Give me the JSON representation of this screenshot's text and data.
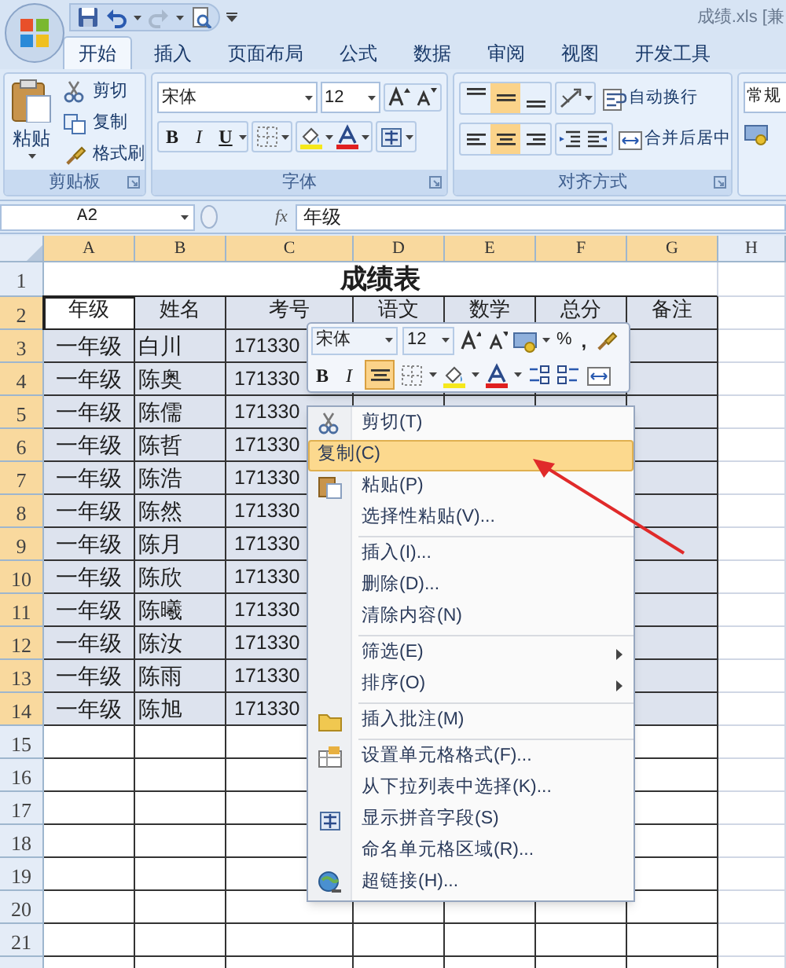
{
  "window": {
    "title": "成绩.xls [兼"
  },
  "tabs": [
    {
      "label": "开始",
      "selected": true
    },
    {
      "label": "插入",
      "selected": false
    },
    {
      "label": "页面布局",
      "selected": false
    },
    {
      "label": "公式",
      "selected": false
    },
    {
      "label": "数据",
      "selected": false
    },
    {
      "label": "审阅",
      "selected": false
    },
    {
      "label": "视图",
      "selected": false
    },
    {
      "label": "开发工具",
      "selected": false
    }
  ],
  "ribbon": {
    "clipboard": {
      "label": "剪贴板",
      "paste": "粘贴",
      "items": [
        "剪切",
        "复制",
        "格式刷"
      ]
    },
    "font": {
      "label": "字体",
      "font": "宋体",
      "size": "12",
      "styles": [
        "B",
        "I",
        "U"
      ]
    },
    "alignment": {
      "label": "对齐方式",
      "vertical": [
        {
          "selected": false
        },
        {
          "selected": true
        },
        {
          "selected": false
        }
      ],
      "horizontal": [
        {
          "selected": false
        },
        {
          "selected": true
        },
        {
          "selected": false
        }
      ],
      "wrap": "自动换行",
      "merge": "合并后居中"
    },
    "number": {
      "format": "常规"
    }
  },
  "formula_bar": {
    "name_box": "A2",
    "function_label": "fx",
    "value": "年级"
  },
  "sheet": {
    "columns": [
      {
        "label": "A",
        "selected": true
      },
      {
        "label": "B",
        "selected": true
      },
      {
        "label": "C",
        "selected": true
      },
      {
        "label": "D",
        "selected": true
      },
      {
        "label": "E",
        "selected": true
      },
      {
        "label": "F",
        "selected": true
      },
      {
        "label": "G",
        "selected": true
      },
      {
        "label": "H",
        "selected": false
      }
    ],
    "rows": [
      {
        "header": "1",
        "selected": false,
        "title": "成绩表"
      },
      {
        "header": "2",
        "selected": true,
        "cells": [
          {
            "text": "年级",
            "active": true
          },
          {
            "text": "姓名",
            "active": false
          },
          {
            "text": "考号",
            "active": false
          },
          {
            "text": "语文",
            "active": false
          },
          {
            "text": "数学",
            "active": false
          },
          {
            "text": "总分",
            "active": false
          },
          {
            "text": "备注",
            "active": false
          }
        ]
      },
      {
        "header": "3",
        "selected": true,
        "cells": [
          {
            "text": "一年级",
            "active": false
          },
          {
            "text": "白川",
            "active": false
          },
          {
            "text": "171330",
            "active": false
          }
        ]
      },
      {
        "header": "4",
        "selected": true,
        "cells": [
          {
            "text": "一年级",
            "active": false
          },
          {
            "text": "陈奥",
            "active": false
          },
          {
            "text": "171330",
            "active": false
          }
        ]
      },
      {
        "header": "5",
        "selected": true,
        "cells": [
          {
            "text": "一年级",
            "active": false
          },
          {
            "text": "陈儒",
            "active": false
          },
          {
            "text": "171330",
            "active": false
          }
        ]
      },
      {
        "header": "6",
        "selected": true,
        "cells": [
          {
            "text": "一年级",
            "active": false
          },
          {
            "text": "陈哲",
            "active": false
          },
          {
            "text": "171330",
            "active": false
          }
        ]
      },
      {
        "header": "7",
        "selected": true,
        "cells": [
          {
            "text": "一年级",
            "active": false
          },
          {
            "text": "陈浩",
            "active": false
          },
          {
            "text": "171330",
            "active": false
          }
        ]
      },
      {
        "header": "8",
        "selected": true,
        "cells": [
          {
            "text": "一年级",
            "active": false
          },
          {
            "text": "陈然",
            "active": false
          },
          {
            "text": "171330",
            "active": false
          }
        ]
      },
      {
        "header": "9",
        "selected": true,
        "cells": [
          {
            "text": "一年级",
            "active": false
          },
          {
            "text": "陈月",
            "active": false
          },
          {
            "text": "171330",
            "active": false
          }
        ]
      },
      {
        "header": "10",
        "selected": true,
        "cells": [
          {
            "text": "一年级",
            "active": false
          },
          {
            "text": "陈欣",
            "active": false
          },
          {
            "text": "171330",
            "active": false
          }
        ]
      },
      {
        "header": "11",
        "selected": true,
        "cells": [
          {
            "text": "一年级",
            "active": false
          },
          {
            "text": "陈曦",
            "active": false
          },
          {
            "text": "171330",
            "active": false
          }
        ]
      },
      {
        "header": "12",
        "selected": true,
        "cells": [
          {
            "text": "一年级",
            "active": false
          },
          {
            "text": "陈汝",
            "active": false
          },
          {
            "text": "171330",
            "active": false
          }
        ]
      },
      {
        "header": "13",
        "selected": true,
        "cells": [
          {
            "text": "一年级",
            "active": false
          },
          {
            "text": "陈雨",
            "active": false
          },
          {
            "text": "171330",
            "active": false
          }
        ]
      },
      {
        "header": "14",
        "selected": true,
        "cells": [
          {
            "text": "一年级",
            "active": false
          },
          {
            "text": "陈旭",
            "active": false
          },
          {
            "text": "171330",
            "active": false
          }
        ]
      },
      {
        "header": "15",
        "selected": false
      },
      {
        "header": "16",
        "selected": false
      },
      {
        "header": "17",
        "selected": false
      },
      {
        "header": "18",
        "selected": false
      },
      {
        "header": "19",
        "selected": false
      },
      {
        "header": "20",
        "selected": false
      },
      {
        "header": "21",
        "selected": false
      }
    ]
  },
  "mini_toolbar": {
    "font": "宋体",
    "size": "12",
    "percent": "%",
    "comma": ",",
    "styles": [
      "B",
      "I"
    ],
    "center_selected": true
  },
  "context_menu": {
    "groups": [
      [
        {
          "label": "剪切(T)",
          "selected": false,
          "submenu": false
        },
        {
          "label": "复制(C)",
          "selected": true,
          "submenu": false
        },
        {
          "label": "粘贴(P)",
          "selected": false,
          "submenu": false
        },
        {
          "label": "选择性粘贴(V)...",
          "selected": false,
          "submenu": false
        }
      ],
      [
        {
          "label": "插入(I)...",
          "selected": false,
          "submenu": false
        },
        {
          "label": "删除(D)...",
          "selected": false,
          "submenu": false
        },
        {
          "label": "清除内容(N)",
          "selected": false,
          "submenu": false
        }
      ],
      [
        {
          "label": "筛选(E)",
          "selected": false,
          "submenu": true
        },
        {
          "label": "排序(O)",
          "selected": false,
          "submenu": true
        }
      ],
      [
        {
          "label": "插入批注(M)",
          "selected": false,
          "submenu": false
        }
      ],
      [
        {
          "label": "设置单元格格式(F)...",
          "selected": false,
          "submenu": false
        },
        {
          "label": "从下拉列表中选择(K)...",
          "selected": false,
          "submenu": false
        },
        {
          "label": "显示拼音字段(S)",
          "selected": false,
          "submenu": false
        },
        {
          "label": "命名单元格区域(R)...",
          "selected": false,
          "submenu": false
        },
        {
          "label": "超链接(H)...",
          "selected": false,
          "submenu": false
        }
      ]
    ]
  }
}
